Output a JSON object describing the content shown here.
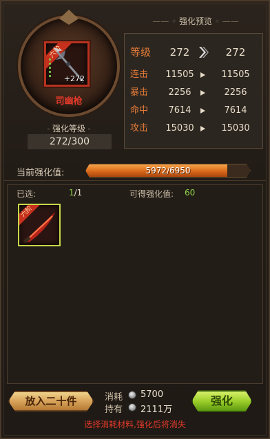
{
  "item": {
    "rank_label": "六阶",
    "level_text": "+272",
    "name": "司幽枪"
  },
  "enhance_level": {
    "label": "强化等级",
    "value": "272/300"
  },
  "preview": {
    "title": "强化预览",
    "stats": [
      {
        "label": "等级",
        "current": "272",
        "next": "272"
      },
      {
        "label": "连击",
        "current": "11505",
        "next": "11505"
      },
      {
        "label": "暴击",
        "current": "2256",
        "next": "2256"
      },
      {
        "label": "命中",
        "current": "7614",
        "next": "7614"
      },
      {
        "label": "攻击",
        "current": "15030",
        "next": "15030"
      }
    ]
  },
  "progress": {
    "label": "当前强化值:",
    "text": "5972/6950",
    "current": 5972,
    "max": 6950
  },
  "materials": {
    "selected_label": "已选:",
    "selected_current": "1",
    "selected_total": "/1",
    "gain_label": "可得强化值:",
    "gain_value": "60",
    "slot_rank": "六阶"
  },
  "footer": {
    "put_button": "放入二十件",
    "cost_label": "消耗",
    "cost_value": "5700",
    "hold_label": "持有",
    "hold_value": "2111万",
    "enhance_button": "强化",
    "hint": "选择消耗材料,强化后将消失"
  },
  "colors": {
    "accent_orange": "#e07a38",
    "name_red": "#e0392a",
    "value_green": "#8fd04a"
  }
}
